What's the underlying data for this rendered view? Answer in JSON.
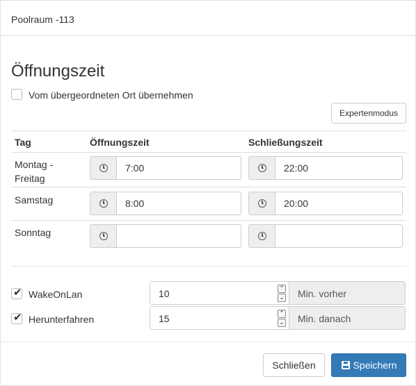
{
  "modal": {
    "title": "Poolraum -113"
  },
  "section": {
    "title": "Öffnungszeit"
  },
  "inherit": {
    "label": "Vom übergeordneten Ort übernehmen",
    "checked": false
  },
  "expert_button": {
    "label": "Expertenmodus"
  },
  "table": {
    "headers": {
      "day": "Tag",
      "open": "Öffnungszeit",
      "close": "Schließungszeit"
    },
    "rows": [
      {
        "day": "Montag - Freitag",
        "open": "7:00",
        "close": "22:00"
      },
      {
        "day": "Samstag",
        "open": "8:00",
        "close": "20:00"
      },
      {
        "day": "Sonntag",
        "open": "",
        "close": ""
      }
    ]
  },
  "wake": {
    "label": "WakeOnLan",
    "checked": true,
    "value": "10",
    "unit": "Min. vorher"
  },
  "shutdown": {
    "label": "Herunterfahren",
    "checked": true,
    "value": "15",
    "unit": "Min. danach"
  },
  "footer": {
    "close_label": "Schließen",
    "save_label": "Speichern"
  },
  "colors": {
    "primary": "#337ab7",
    "border": "#cccccc",
    "addon_bg": "#eeeeee"
  },
  "icons": {
    "time": "clock-icon",
    "save": "floppy-disk-icon",
    "check": "checkmark-icon"
  }
}
